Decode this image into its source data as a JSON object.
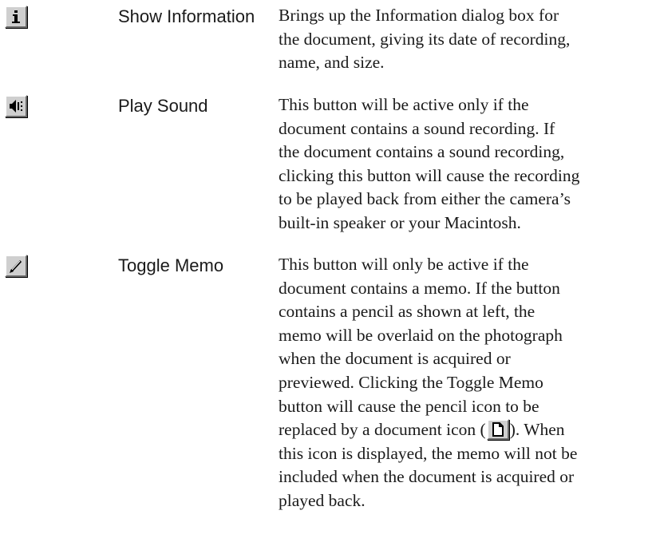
{
  "items": [
    {
      "icon": "info-icon",
      "label": "Show Information",
      "lines": [
        "Brings up the Information dialog box for",
        "the document, giving its date of recording,",
        "name, and size."
      ]
    },
    {
      "icon": "speaker-icon",
      "label": "Play Sound",
      "lines": [
        "This button will be active only if the",
        "document contains a sound recording.  If",
        "the document contains a sound recording,",
        "clicking this button will cause the recording",
        "to be played back from either the camera’s",
        "built-in speaker or your Macintosh."
      ]
    },
    {
      "icon": "pencil-icon",
      "label": "Toggle Memo",
      "lines": [
        "This button will only be active if the",
        "document contains a memo.  If the button",
        "contains a pencil as shown at left, the",
        "memo will be overlaid on the photograph",
        "when the document is acquired or",
        "previewed.  Clicking the Toggle Memo",
        "button will cause the pencil icon to be"
      ],
      "inline_before": "replaced by a document icon (",
      "inline_icon": "document-icon",
      "inline_after": ").  When",
      "lines_after": [
        "this icon is displayed, the memo will not be",
        "included when the document is acquired or",
        "played back."
      ]
    }
  ]
}
